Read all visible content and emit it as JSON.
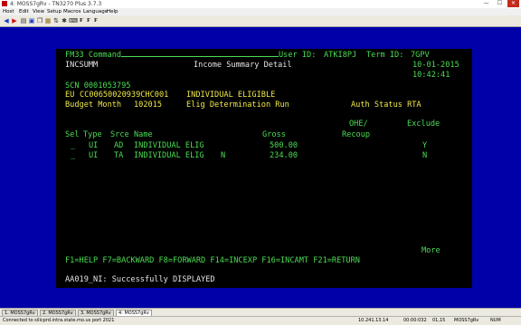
{
  "window": {
    "title": "4: MOSS7gRv - TN3270 Plus 3.7.3",
    "minimize_glyph": "—",
    "maximize_glyph": "☐",
    "close_glyph": "✕"
  },
  "menu": {
    "items": [
      "Host",
      "Edit",
      "View",
      "Setup",
      "Macros",
      "Language",
      "Help"
    ]
  },
  "toolbar": {
    "font_buttons": [
      "F",
      "F",
      "F"
    ],
    "icons": [
      "left-arrow-icon",
      "right-arrow-icon",
      "print-icon",
      "save-icon",
      "copy-icon",
      "paste-icon",
      "transfer-icon",
      "settings-icon",
      "keyboard-icon"
    ]
  },
  "screen": {
    "line1": {
      "tran": "FM33 Command",
      "user_label": "User ID:",
      "user": "ATKI8PJ",
      "term_label": "Term ID:",
      "term": "7GPV"
    },
    "line2": {
      "screen_id": "INCSUMM",
      "title": "Income Summary Detail",
      "date": "10-01-2015"
    },
    "time": "10:42:41",
    "scn": "SCN 0001053795",
    "eu": {
      "prefix": "EU",
      "id": "CC00650020939CHC001",
      "desc": "INDIVIDUAL ELIGIBLE"
    },
    "budget": {
      "label": "Budget Month",
      "value": "102015",
      "run_label": "Elig Determination Run",
      "status_label": "Auth Status RTA"
    },
    "col_head_top": {
      "ohe": "OHE/",
      "exclude": "Exclude"
    },
    "col_head": {
      "sel": "Sel",
      "type": "Type",
      "srce": "Srce",
      "name": "Name",
      "gross": "Gross",
      "recoup": "Recoup"
    },
    "rows": [
      {
        "sel": "_",
        "type": "UI",
        "srce": "AD",
        "name": "INDIVIDUAL ELIG",
        "flag": "",
        "gross": "500.00",
        "exclude": "Y"
      },
      {
        "sel": "_",
        "type": "UI",
        "srce": "TA",
        "name": "INDIVIDUAL ELIG",
        "flag": "N",
        "gross": "234.00",
        "exclude": "N"
      }
    ],
    "more": "More",
    "pfkeys": "F1=HELP F7=BACKWARD F8=FORWARD F14=INCEXP F16=INCAMT F21=RETURN",
    "message": "AA019_NI: Successfully DISPLAYED"
  },
  "tabs": [
    "1. MOSS7gRv",
    "2. MOSS7gRv",
    "3. MOSS7gRv",
    "4: MOSS7gRv"
  ],
  "status": {
    "connection": "Connected to silicprd.intra.state.mo.us port 2021",
    "ip": "10.241.13.14",
    "timer": "00:00:032",
    "cursor": "01,15",
    "session": "MOSS7gRv",
    "num": "NUM"
  },
  "colors": {
    "terminal_border": "#0000a8",
    "screen_bg": "#000000",
    "field_text": "#4cdc54",
    "protected_text": "#e4e4e4"
  }
}
